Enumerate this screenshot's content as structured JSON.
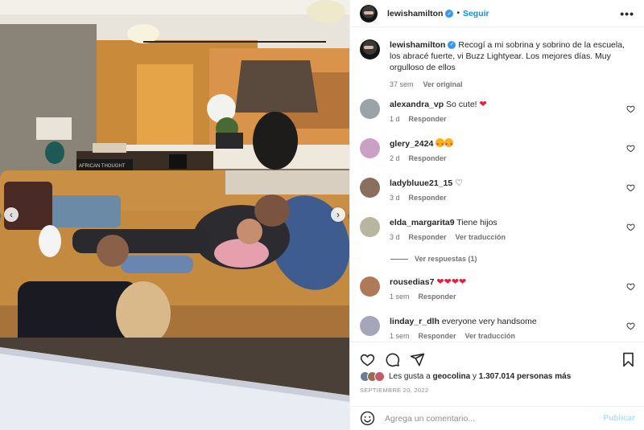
{
  "post": {
    "username": "lewishamilton",
    "follow_label": "Seguir",
    "separator": "•",
    "more_label": "•••",
    "caption": "Recogí a mi sobrina y sobrino de la escuela, los abracé fuerte, vi Buzz Lightyear. Los mejores días. Muy orgulloso de ellos",
    "caption_age": "37 sem",
    "see_translation": "Ver original",
    "likes_prefix": "Les gusta a",
    "likes_user": "geocolina",
    "likes_joiner": "y",
    "likes_count": "1.307.014 personas más",
    "date": "SEPTIEMBRE 20, 2022",
    "comment_placeholder": "Agrega un comentario...",
    "post_label": "Publicar"
  },
  "media": {
    "book_text": "AFRICAN THOUGHT",
    "prev_label": "‹",
    "next_label": "›"
  },
  "comments": [
    {
      "username": "alexandra_vp",
      "text": "So cute! ",
      "emoji": "heart-red",
      "age": "1 d",
      "reply": "Responder",
      "avatar_color": "#9aa3a8"
    },
    {
      "username": "glery_2424",
      "text": "",
      "emoji": "heart-eyes-x2",
      "age": "2 d",
      "reply": "Responder",
      "avatar_color": "#c9a0c6"
    },
    {
      "username": "ladybluue21_15",
      "text": "",
      "emoji": "heart-outline",
      "age": "3 d",
      "reply": "Responder",
      "avatar_color": "#8a6e5e"
    },
    {
      "username": "elda_margarita9",
      "text": "Tiene hijos",
      "emoji": "",
      "age": "3 d",
      "reply": "Responder",
      "translate": "Ver traducción",
      "avatar_color": "#b8b5a0",
      "view_replies": "Ver respuestas (1)"
    },
    {
      "username": "rousedias7",
      "text": "",
      "emoji": "heart-red-x4",
      "age": "1 sem",
      "reply": "Responder",
      "avatar_color": "#b07a5a"
    },
    {
      "username": "linday_r_dlh",
      "text": "everyone very handsome",
      "emoji": "",
      "age": "1 sem",
      "reply": "Responder",
      "translate": "Ver traducción",
      "avatar_color": "#a6a6ba"
    }
  ],
  "colors": {
    "accent": "#0095f6",
    "verified": "#3897f0",
    "muted": "#737373",
    "heart": "#ed1c3a"
  }
}
